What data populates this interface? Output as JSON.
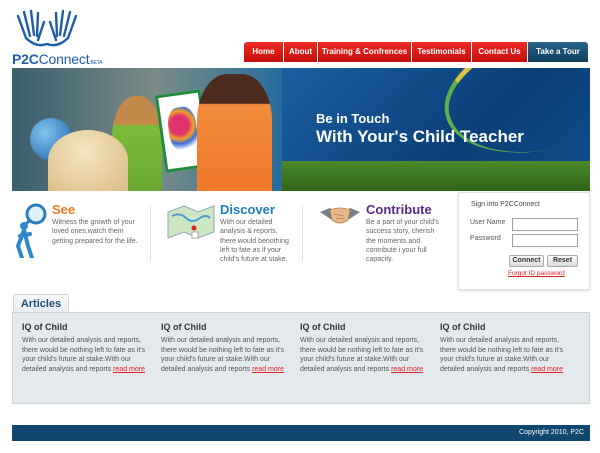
{
  "logo": {
    "name_prefix": "P2C",
    "name_suffix": "Connect",
    "badge": "BETA"
  },
  "nav": {
    "items": [
      {
        "label": "Home"
      },
      {
        "label": "About"
      },
      {
        "label": "Training & Confrences"
      },
      {
        "label": "Testimonials"
      },
      {
        "label": "Contact Us"
      },
      {
        "label": "Take a Tour"
      }
    ]
  },
  "banner": {
    "line1": "Be in Touch",
    "line2": "With Your's Child Teacher"
  },
  "features": [
    {
      "title": "See",
      "text": "Witness the growth of your loved ones,watch them getting prepared for the life.",
      "color": "#f07c1e"
    },
    {
      "title": "Discover",
      "text": "With our detailed analysis & reports, there would benothing left to fate as if your child's future at stake.",
      "color": "#1d7fc1"
    },
    {
      "title": "Contribute",
      "text": "Be a part of your child's success story, cherish the moments and contribute i your full capacity.",
      "color": "#5a2b8a"
    }
  ],
  "signin": {
    "title": "Sign into P2CConnect",
    "username_label": "User Name",
    "password_label": "Password",
    "username_value": "",
    "password_value": "",
    "connect_label": "Connect",
    "reset_label": "Reset",
    "forgot_label": "Forgot ID password"
  },
  "articles": {
    "tab_label": "Articles",
    "items": [
      {
        "title": "IQ of Child",
        "text": "With our detailed analysis and reports, there would be nothing left to fate as it's your child's future at stake.With our detailed analysis and reports",
        "more": "read more"
      },
      {
        "title": "IQ of Child",
        "text": "With our detailed analysis and reports, there would be nothing left to fate as it's your child's future at stake.With our detailed analysis and reports",
        "more": "read more"
      },
      {
        "title": "IQ of Child",
        "text": "With our detailed analysis and reports, there would be nothing left to fate as it's your child's future at stake.With our detailed analysis and reports",
        "more": "read more"
      },
      {
        "title": "IQ of Child",
        "text": "With our detailed analysis and reports, there would be nothing left to fate as it's your child's future at stake.With our detailed analysis and reports",
        "more": "read more"
      }
    ]
  },
  "footer": {
    "copyright": "Copyright 2010, P2C"
  },
  "colors": {
    "nav_red": "#e0201c",
    "nav_dark": "#10476e",
    "link_red": "#dd2222",
    "brand_blue": "#1e5ea8"
  }
}
